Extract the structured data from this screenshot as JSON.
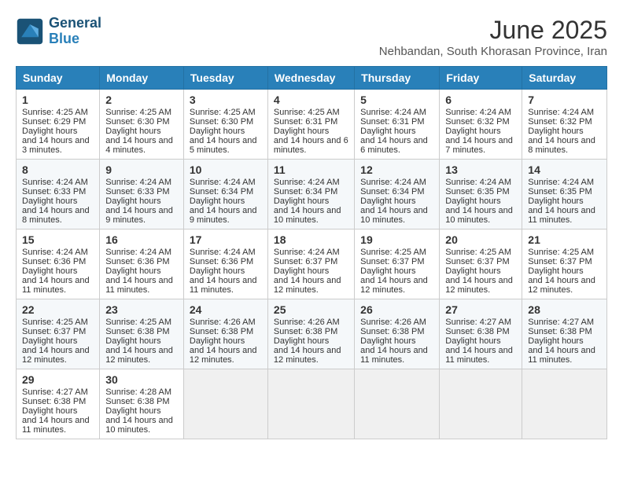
{
  "logo": {
    "line1": "General",
    "line2": "Blue"
  },
  "title": "June 2025",
  "subtitle": "Nehbandan, South Khorasan Province, Iran",
  "headers": [
    "Sunday",
    "Monday",
    "Tuesday",
    "Wednesday",
    "Thursday",
    "Friday",
    "Saturday"
  ],
  "weeks": [
    [
      {
        "day": "1",
        "sunrise": "4:25 AM",
        "sunset": "6:29 PM",
        "daylight": "14 hours and 3 minutes."
      },
      {
        "day": "2",
        "sunrise": "4:25 AM",
        "sunset": "6:30 PM",
        "daylight": "14 hours and 4 minutes."
      },
      {
        "day": "3",
        "sunrise": "4:25 AM",
        "sunset": "6:30 PM",
        "daylight": "14 hours and 5 minutes."
      },
      {
        "day": "4",
        "sunrise": "4:25 AM",
        "sunset": "6:31 PM",
        "daylight": "14 hours and 6 minutes."
      },
      {
        "day": "5",
        "sunrise": "4:24 AM",
        "sunset": "6:31 PM",
        "daylight": "14 hours and 6 minutes."
      },
      {
        "day": "6",
        "sunrise": "4:24 AM",
        "sunset": "6:32 PM",
        "daylight": "14 hours and 7 minutes."
      },
      {
        "day": "7",
        "sunrise": "4:24 AM",
        "sunset": "6:32 PM",
        "daylight": "14 hours and 8 minutes."
      }
    ],
    [
      {
        "day": "8",
        "sunrise": "4:24 AM",
        "sunset": "6:33 PM",
        "daylight": "14 hours and 8 minutes."
      },
      {
        "day": "9",
        "sunrise": "4:24 AM",
        "sunset": "6:33 PM",
        "daylight": "14 hours and 9 minutes."
      },
      {
        "day": "10",
        "sunrise": "4:24 AM",
        "sunset": "6:34 PM",
        "daylight": "14 hours and 9 minutes."
      },
      {
        "day": "11",
        "sunrise": "4:24 AM",
        "sunset": "6:34 PM",
        "daylight": "14 hours and 10 minutes."
      },
      {
        "day": "12",
        "sunrise": "4:24 AM",
        "sunset": "6:34 PM",
        "daylight": "14 hours and 10 minutes."
      },
      {
        "day": "13",
        "sunrise": "4:24 AM",
        "sunset": "6:35 PM",
        "daylight": "14 hours and 10 minutes."
      },
      {
        "day": "14",
        "sunrise": "4:24 AM",
        "sunset": "6:35 PM",
        "daylight": "14 hours and 11 minutes."
      }
    ],
    [
      {
        "day": "15",
        "sunrise": "4:24 AM",
        "sunset": "6:36 PM",
        "daylight": "14 hours and 11 minutes."
      },
      {
        "day": "16",
        "sunrise": "4:24 AM",
        "sunset": "6:36 PM",
        "daylight": "14 hours and 11 minutes."
      },
      {
        "day": "17",
        "sunrise": "4:24 AM",
        "sunset": "6:36 PM",
        "daylight": "14 hours and 11 minutes."
      },
      {
        "day": "18",
        "sunrise": "4:24 AM",
        "sunset": "6:37 PM",
        "daylight": "14 hours and 12 minutes."
      },
      {
        "day": "19",
        "sunrise": "4:25 AM",
        "sunset": "6:37 PM",
        "daylight": "14 hours and 12 minutes."
      },
      {
        "day": "20",
        "sunrise": "4:25 AM",
        "sunset": "6:37 PM",
        "daylight": "14 hours and 12 minutes."
      },
      {
        "day": "21",
        "sunrise": "4:25 AM",
        "sunset": "6:37 PM",
        "daylight": "14 hours and 12 minutes."
      }
    ],
    [
      {
        "day": "22",
        "sunrise": "4:25 AM",
        "sunset": "6:37 PM",
        "daylight": "14 hours and 12 minutes."
      },
      {
        "day": "23",
        "sunrise": "4:25 AM",
        "sunset": "6:38 PM",
        "daylight": "14 hours and 12 minutes."
      },
      {
        "day": "24",
        "sunrise": "4:26 AM",
        "sunset": "6:38 PM",
        "daylight": "14 hours and 12 minutes."
      },
      {
        "day": "25",
        "sunrise": "4:26 AM",
        "sunset": "6:38 PM",
        "daylight": "14 hours and 12 minutes."
      },
      {
        "day": "26",
        "sunrise": "4:26 AM",
        "sunset": "6:38 PM",
        "daylight": "14 hours and 11 minutes."
      },
      {
        "day": "27",
        "sunrise": "4:27 AM",
        "sunset": "6:38 PM",
        "daylight": "14 hours and 11 minutes."
      },
      {
        "day": "28",
        "sunrise": "4:27 AM",
        "sunset": "6:38 PM",
        "daylight": "14 hours and 11 minutes."
      }
    ],
    [
      {
        "day": "29",
        "sunrise": "4:27 AM",
        "sunset": "6:38 PM",
        "daylight": "14 hours and 11 minutes."
      },
      {
        "day": "30",
        "sunrise": "4:28 AM",
        "sunset": "6:38 PM",
        "daylight": "14 hours and 10 minutes."
      },
      null,
      null,
      null,
      null,
      null
    ]
  ]
}
